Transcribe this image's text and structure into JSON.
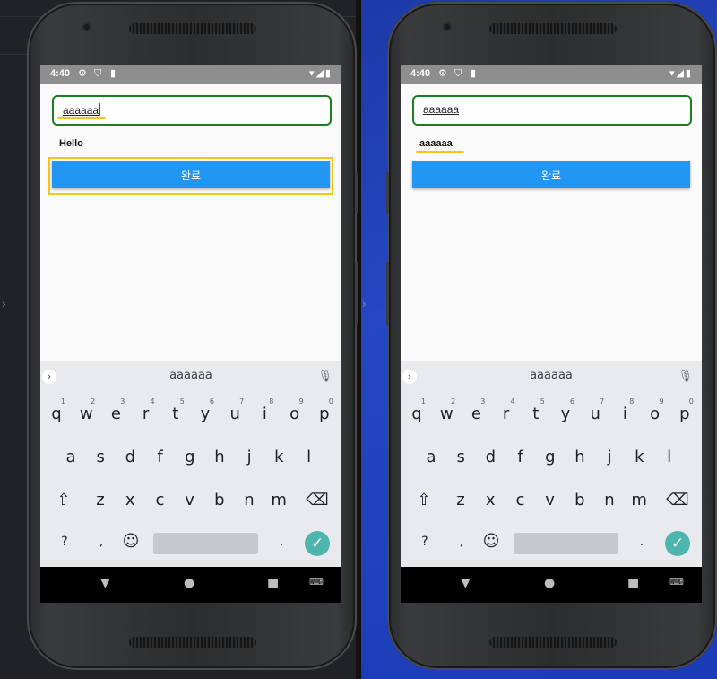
{
  "panels": [
    {
      "id": "left",
      "status_time": "4:40",
      "input_value": "aaaaaa",
      "result_label": "Hello",
      "button_label": "완료",
      "suggestion": "aaaaaa"
    },
    {
      "id": "right",
      "status_time": "4:40",
      "input_value": "aaaaaa",
      "result_label": "aaaaaa",
      "button_label": "완료",
      "suggestion": "aaaaaa"
    }
  ],
  "keyboard": {
    "row1": [
      {
        "k": "q",
        "n": "1"
      },
      {
        "k": "w",
        "n": "2"
      },
      {
        "k": "e",
        "n": "3"
      },
      {
        "k": "r",
        "n": "4"
      },
      {
        "k": "t",
        "n": "5"
      },
      {
        "k": "y",
        "n": "6"
      },
      {
        "k": "u",
        "n": "7"
      },
      {
        "k": "i",
        "n": "8"
      },
      {
        "k": "o",
        "n": "9"
      },
      {
        "k": "p",
        "n": "0"
      }
    ],
    "row2": [
      "a",
      "s",
      "d",
      "f",
      "g",
      "h",
      "j",
      "k",
      "l"
    ],
    "row3": [
      "z",
      "x",
      "c",
      "v",
      "b",
      "n",
      "m"
    ],
    "shift_icon": "⇧",
    "backspace_icon": "⌫",
    "sym_label": "?123",
    "comma": ",",
    "emoji_icon": "☺",
    "period": ".",
    "enter_icon": "✓"
  },
  "colors": {
    "accent_button": "#2196f3",
    "input_border": "#1e7d22",
    "highlight": "#f5c518",
    "enter_key": "#4db6ac"
  }
}
